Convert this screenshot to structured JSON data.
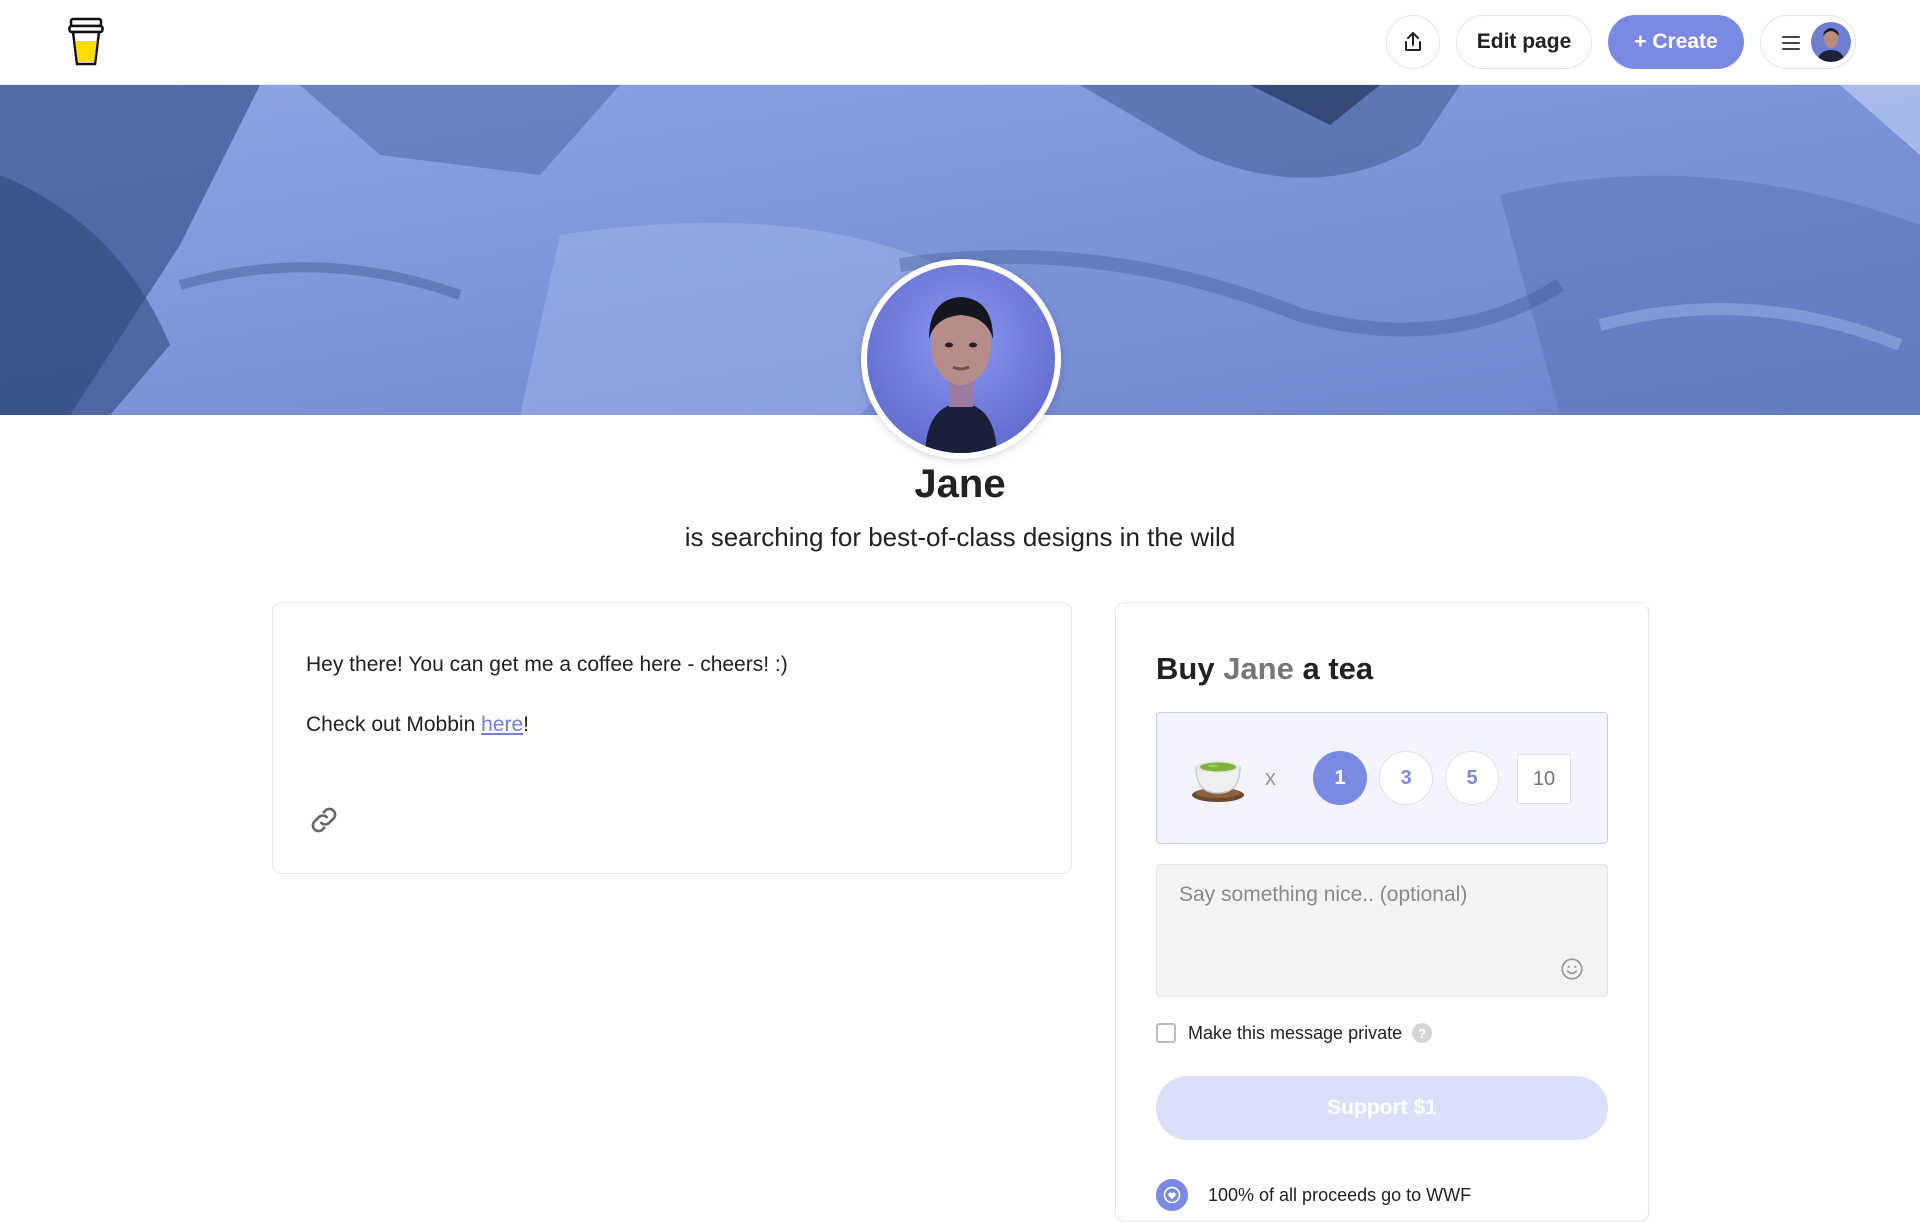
{
  "header": {
    "edit_label": "Edit page",
    "create_label": "+ Create"
  },
  "profile": {
    "name": "Jane",
    "tagline": "is searching for best-of-class designs in the wild"
  },
  "about": {
    "line1": "Hey there! You can get me a coffee here - cheers! :)",
    "line2_prefix": "Check out Mobbin ",
    "line2_link": "here",
    "line2_suffix": "!"
  },
  "support": {
    "title_prefix": "Buy ",
    "title_name": "Jane",
    "title_suffix": " a tea",
    "multiplier": "x",
    "quantities": [
      "1",
      "3",
      "5"
    ],
    "selected_quantity": "1",
    "custom_quantity_placeholder": "10",
    "message_placeholder": "Say something nice.. (optional)",
    "private_label": "Make this message private",
    "help_symbol": "?",
    "button_label": "Support $1",
    "proceeds_text": "100% of all proceeds go to WWF"
  },
  "colors": {
    "accent": "#7a8ae3",
    "accent_light": "#dcdffa",
    "cover_blue": "#6a82c8"
  },
  "icons": {
    "logo": "coffee-cup-logo",
    "share": "share-icon",
    "menu": "hamburger-icon",
    "link": "link-icon",
    "tea": "tea-bowl-icon",
    "emoji": "smiley-icon",
    "proceeds": "heart-globe-icon"
  }
}
